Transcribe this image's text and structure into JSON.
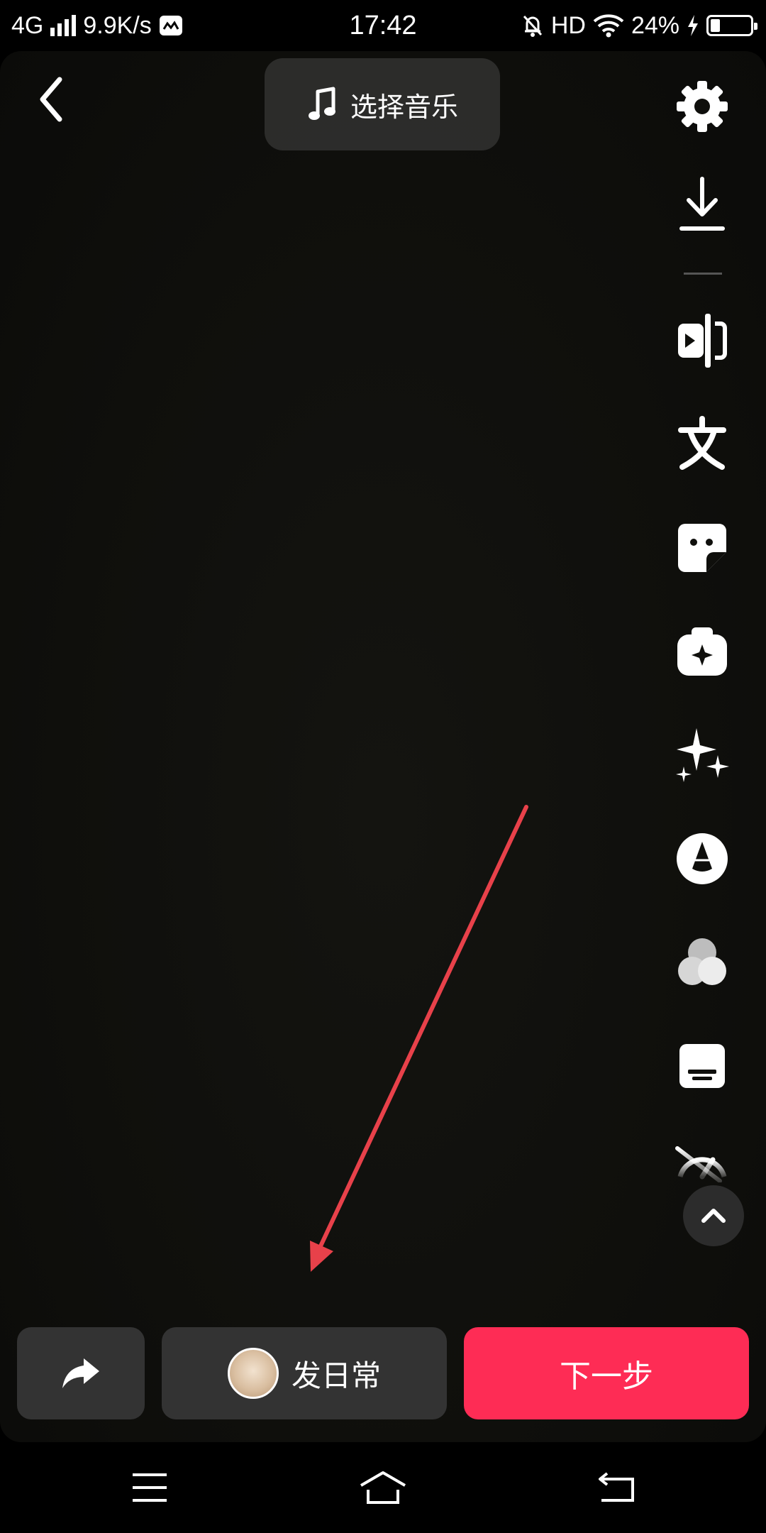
{
  "status_bar": {
    "network": "4G",
    "speed": "9.9K/s",
    "time": "17:42",
    "hd": "HD",
    "battery": "24%",
    "battery_level": 0.24
  },
  "header": {
    "music_label": "选择音乐"
  },
  "side_tools": [
    {
      "icon": "gear-icon"
    },
    {
      "icon": "download-icon"
    },
    {
      "icon": "clip-icon"
    },
    {
      "icon": "text-icon"
    },
    {
      "icon": "sticker-icon"
    },
    {
      "icon": "effect-icon"
    },
    {
      "icon": "sparkle-icon"
    },
    {
      "icon": "beauty-icon"
    },
    {
      "icon": "filter-icon"
    },
    {
      "icon": "subtitle-icon"
    },
    {
      "icon": "speed-icon"
    }
  ],
  "bottom": {
    "daily_label": "发日常",
    "next_label": "下一步"
  },
  "colors": {
    "accent": "#fe2c55",
    "annotation": "#e8414a"
  }
}
